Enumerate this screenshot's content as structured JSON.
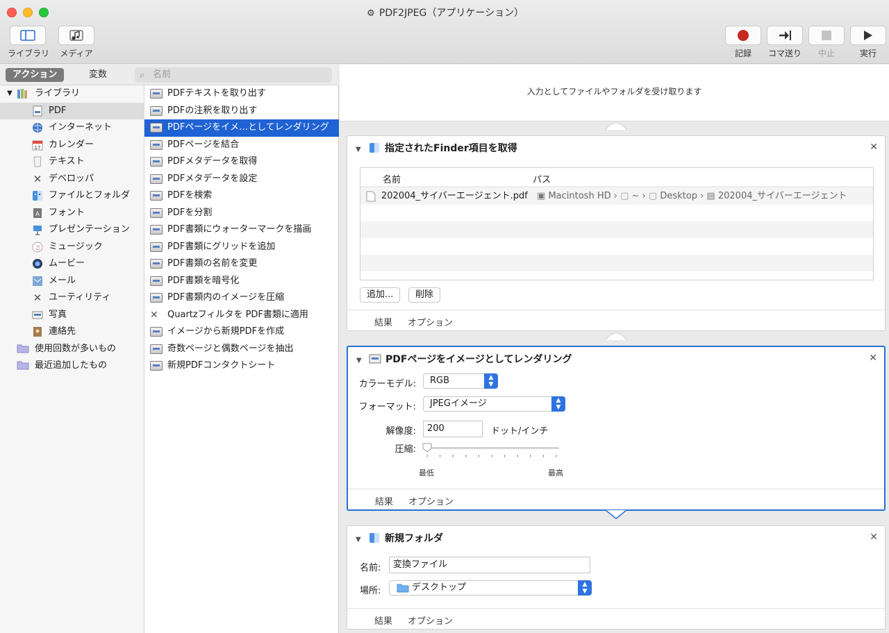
{
  "window": {
    "title": "PDF2JPEG（アプリケーション）"
  },
  "toolbar": {
    "library_label": "ライブラリ",
    "media_label": "メディア",
    "record_label": "記録",
    "step_label": "コマ送り",
    "stop_label": "中止",
    "run_label": "実行"
  },
  "segments": {
    "actions": "アクション",
    "variables": "変数"
  },
  "search": {
    "placeholder": "名前"
  },
  "library": {
    "root": "ライブラリ",
    "items": [
      {
        "label": "PDF",
        "icon": "pdf-icon"
      },
      {
        "label": "インターネット",
        "icon": "globe-icon"
      },
      {
        "label": "カレンダー",
        "icon": "calendar-icon"
      },
      {
        "label": "テキスト",
        "icon": "text-icon"
      },
      {
        "label": "デベロッパ",
        "icon": "tools-icon"
      },
      {
        "label": "ファイルとフォルダ",
        "icon": "finder-icon"
      },
      {
        "label": "フォント",
        "icon": "font-icon"
      },
      {
        "label": "プレゼンテーション",
        "icon": "presentation-icon"
      },
      {
        "label": "ミュージック",
        "icon": "music-icon"
      },
      {
        "label": "ムービー",
        "icon": "quicktime-icon"
      },
      {
        "label": "メール",
        "icon": "mail-icon"
      },
      {
        "label": "ユーティリティ",
        "icon": "utility-icon"
      },
      {
        "label": "写真",
        "icon": "photo-icon"
      },
      {
        "label": "連絡先",
        "icon": "contacts-icon"
      }
    ],
    "smart": [
      {
        "label": "使用回数が多いもの"
      },
      {
        "label": "最近追加したもの"
      }
    ]
  },
  "actions": [
    "PDFテキストを取り出す",
    "PDFの注釈を取り出す",
    "PDFページをイメ…としてレンダリング",
    "PDFページを結合",
    "PDFメタデータを取得",
    "PDFメタデータを設定",
    "PDFを検索",
    "PDFを分割",
    "PDF書類にウォーターマークを描画",
    "PDF書類にグリッドを追加",
    "PDF書類の名前を変更",
    "PDF書類を暗号化",
    "PDF書類内のイメージを圧縮",
    "Quartzフィルタを PDF書類に適用",
    "イメージから新規PDFを作成",
    "奇数ページと偶数ページを抽出",
    "新規PDFコンタクトシート"
  ],
  "workflow": {
    "input_text": "入力としてファイルやフォルダを受け取ります",
    "card1": {
      "title": "指定されたFinder項目を取得",
      "col_name": "名前",
      "col_path": "パス",
      "file_name": "202004_サイバーエージェント.pdf",
      "path_parts": [
        "Macintosh HD",
        "~",
        "Desktop",
        "202004_サイバーエージェント"
      ],
      "add_button": "追加...",
      "delete_button": "削除",
      "results": "結果",
      "options": "オプション"
    },
    "card2": {
      "title": "PDFページをイメージとしてレンダリング",
      "color_model_label": "カラーモデル:",
      "color_model_value": "RGB",
      "format_label": "フォーマット:",
      "format_value": "JPEGイメージ",
      "resolution_label": "解像度:",
      "resolution_value": "200",
      "resolution_unit": "ドット/インチ",
      "compression_label": "圧縮:",
      "compression_min": "最低",
      "compression_max": "最高",
      "compression_level": 0,
      "results": "結果",
      "options": "オプション"
    },
    "card3": {
      "title": "新規フォルダ",
      "name_label": "名前:",
      "name_value": "変換ファイル",
      "location_label": "場所:",
      "location_value": "デスクトップ",
      "results": "結果",
      "options": "オプション"
    }
  },
  "colors": {
    "accent": "#1f62d3",
    "focus_border": "#2a6fd6",
    "record": "#c6281e"
  }
}
